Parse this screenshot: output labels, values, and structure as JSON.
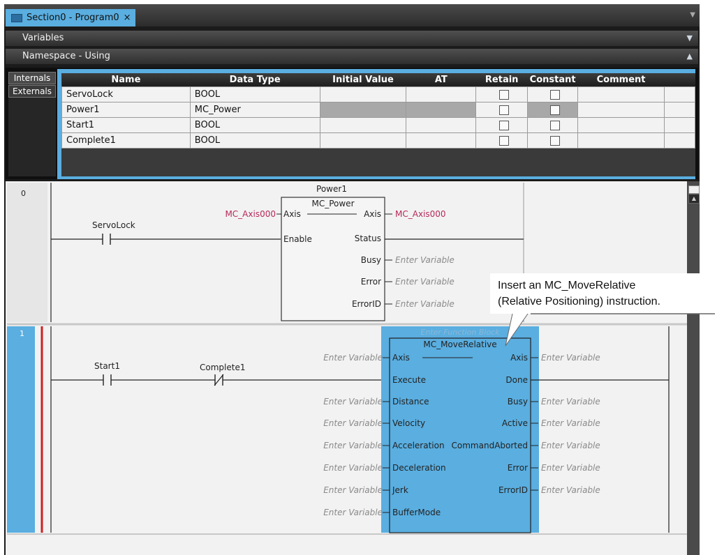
{
  "tab": {
    "title": "Section0 - Program0",
    "close": "×"
  },
  "panels": {
    "variables": "Variables",
    "namespace": "Namespace - Using"
  },
  "side_tabs": {
    "internals": "Internals",
    "externals": "Externals"
  },
  "table": {
    "headers": [
      "Name",
      "Data Type",
      "Initial Value",
      "AT",
      "Retain",
      "Constant",
      "Comment"
    ],
    "rows": [
      {
        "name": "ServoLock",
        "type": "BOOL"
      },
      {
        "name": "Power1",
        "type": "MC_Power"
      },
      {
        "name": "Start1",
        "type": "BOOL"
      },
      {
        "name": "Complete1",
        "type": "BOOL"
      }
    ]
  },
  "rung0": {
    "number": "0",
    "contact": "ServoLock",
    "instance": "Power1",
    "fb_type": "MC_Power",
    "in_var": "MC_Axis000",
    "out_var": "MC_Axis000",
    "inputs": [
      "Axis",
      "Enable"
    ],
    "outputs": [
      "Axis",
      "Status",
      "Busy",
      "Error",
      "ErrorID"
    ],
    "placeholder": "Enter Variable"
  },
  "rung1": {
    "number": "1",
    "contact1": "Start1",
    "contact2": "Complete1",
    "fb_placeholder": "Enter Function Block",
    "fb_type": "MC_MoveRelative",
    "inputs": [
      "Axis",
      "Execute",
      "Distance",
      "Velocity",
      "Acceleration",
      "Deceleration",
      "Jerk",
      "BufferMode"
    ],
    "outputs": [
      "Axis",
      "Done",
      "Busy",
      "Active",
      "CommandAborted",
      "Error",
      "ErrorID"
    ],
    "placeholder": "Enter Variable"
  },
  "callout": {
    "line1": "Insert an MC_MoveRelative",
    "line2": "(Relative Positioning) instruction."
  },
  "colors": {
    "accent": "#5aaee0",
    "variable": "#b5295a",
    "rail": "#d01f1f",
    "dark": "#1b1b1b"
  }
}
